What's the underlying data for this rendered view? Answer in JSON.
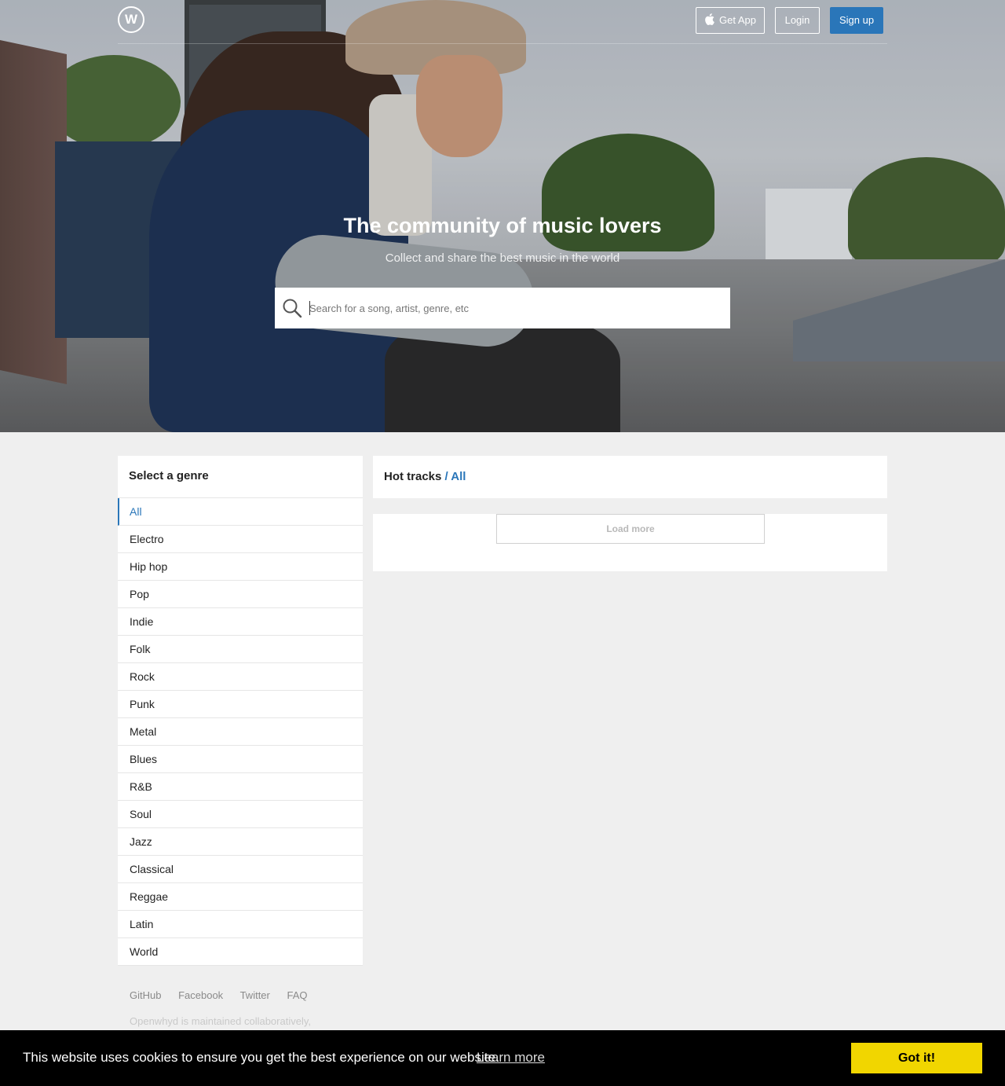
{
  "header": {
    "logo_letter": "W",
    "get_app_label": "Get App",
    "login_label": "Login",
    "signup_label": "Sign up"
  },
  "hero": {
    "title": "The community of music lovers",
    "subtitle": "Collect and share the best music in the world",
    "search_placeholder": "Search for a song, artist, genre, etc"
  },
  "genres": {
    "title": "Select a genre",
    "items": [
      {
        "label": "All"
      },
      {
        "label": "Electro"
      },
      {
        "label": "Hip hop"
      },
      {
        "label": "Pop"
      },
      {
        "label": "Indie"
      },
      {
        "label": "Folk"
      },
      {
        "label": "Rock"
      },
      {
        "label": "Punk"
      },
      {
        "label": "Metal"
      },
      {
        "label": "Blues"
      },
      {
        "label": "R&B"
      },
      {
        "label": "Soul"
      },
      {
        "label": "Jazz"
      },
      {
        "label": "Classical"
      },
      {
        "label": "Reggae"
      },
      {
        "label": "Latin"
      },
      {
        "label": "World"
      }
    ],
    "active": "All"
  },
  "hot_tracks": {
    "title": "Hot tracks",
    "filter": "/ All",
    "load_more_label": "Load more"
  },
  "footer": {
    "links": [
      "GitHub",
      "Facebook",
      "Twitter",
      "FAQ"
    ],
    "note": "Openwhyd is maintained collaboratively,"
  },
  "cookie": {
    "message": "This website uses cookies to ensure you get the best experience on our website.",
    "learn_more": "Learn more",
    "accept": "Got it!"
  },
  "colors": {
    "accent": "#2a76b9",
    "cookie_button": "#f1d600",
    "page_bg": "#efefef"
  },
  "icons": {
    "logo": "w-circle-logo",
    "apple": "apple-icon",
    "search": "search-icon"
  }
}
